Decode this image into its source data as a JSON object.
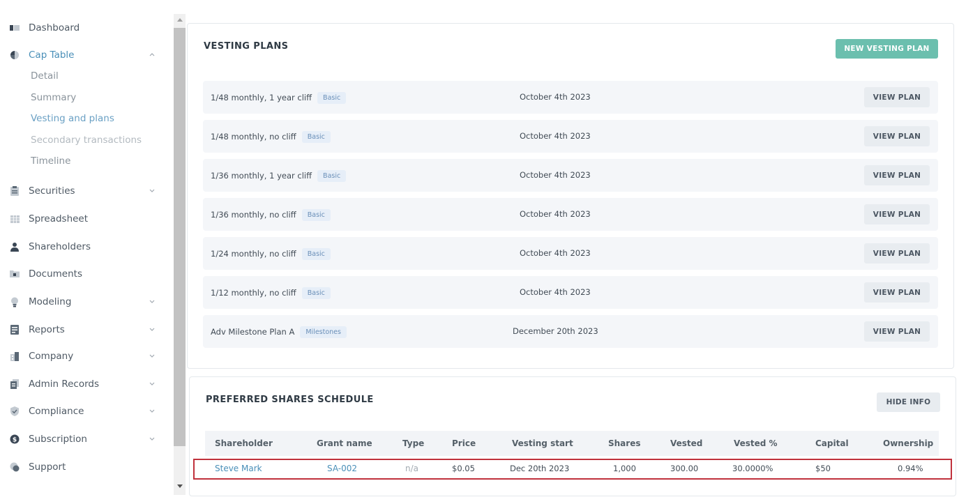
{
  "sidebar": {
    "items": [
      {
        "label": "Dashboard",
        "icon": "dashboard-icon"
      },
      {
        "label": "Cap Table",
        "icon": "pie-chart-icon",
        "expanded": true
      },
      {
        "label": "Securities",
        "icon": "clipboard-icon"
      },
      {
        "label": "Spreadsheet",
        "icon": "table-icon"
      },
      {
        "label": "Shareholders",
        "icon": "person-icon"
      },
      {
        "label": "Documents",
        "icon": "folder-icon"
      },
      {
        "label": "Modeling",
        "icon": "lightbulb-icon"
      },
      {
        "label": "Reports",
        "icon": "report-icon"
      },
      {
        "label": "Company",
        "icon": "building-icon"
      },
      {
        "label": "Admin Records",
        "icon": "records-icon"
      },
      {
        "label": "Compliance",
        "icon": "shield-check-icon"
      },
      {
        "label": "Subscription",
        "icon": "dollar-icon"
      },
      {
        "label": "Support",
        "icon": "support-icon"
      }
    ],
    "cap_table_sub": [
      "Detail",
      "Summary",
      "Vesting and plans",
      "Secondary transactions",
      "Timeline"
    ]
  },
  "vesting": {
    "title": "VESTING PLANS",
    "new_button": "NEW VESTING PLAN",
    "view_label": "VIEW PLAN",
    "plans": [
      {
        "name": "1/48 monthly, 1 year cliff",
        "tag": "Basic",
        "date": "October 4th 2023"
      },
      {
        "name": "1/48 monthly, no cliff",
        "tag": "Basic",
        "date": "October 4th 2023"
      },
      {
        "name": "1/36 monthly, 1 year cliff",
        "tag": "Basic",
        "date": "October 4th 2023"
      },
      {
        "name": "1/36 monthly, no cliff",
        "tag": "Basic",
        "date": "October 4th 2023"
      },
      {
        "name": "1/24 monthly, no cliff",
        "tag": "Basic",
        "date": "October 4th 2023"
      },
      {
        "name": "1/12 monthly, no cliff",
        "tag": "Basic",
        "date": "October 4th 2023"
      },
      {
        "name": "Adv Milestone Plan A",
        "tag": "Milestones",
        "date": "December 20th 2023"
      }
    ]
  },
  "preferred": {
    "title": "PREFERRED SHARES SCHEDULE",
    "hide_button": "HIDE INFO",
    "columns": [
      "Shareholder",
      "Grant name",
      "Type",
      "Price",
      "Vesting start",
      "Shares",
      "Vested",
      "Vested %",
      "Capital",
      "Ownership"
    ],
    "rows": [
      [
        "Steve Mark",
        "SA-002",
        "n/a",
        "$0.05",
        "Dec 20th 2023",
        "1,000",
        "300.00",
        "30.0000%",
        "$50",
        "0.94%"
      ]
    ]
  },
  "colors": {
    "accent": "#6bbfae",
    "link": "#4a8fb8",
    "highlight": "#c0313c"
  }
}
